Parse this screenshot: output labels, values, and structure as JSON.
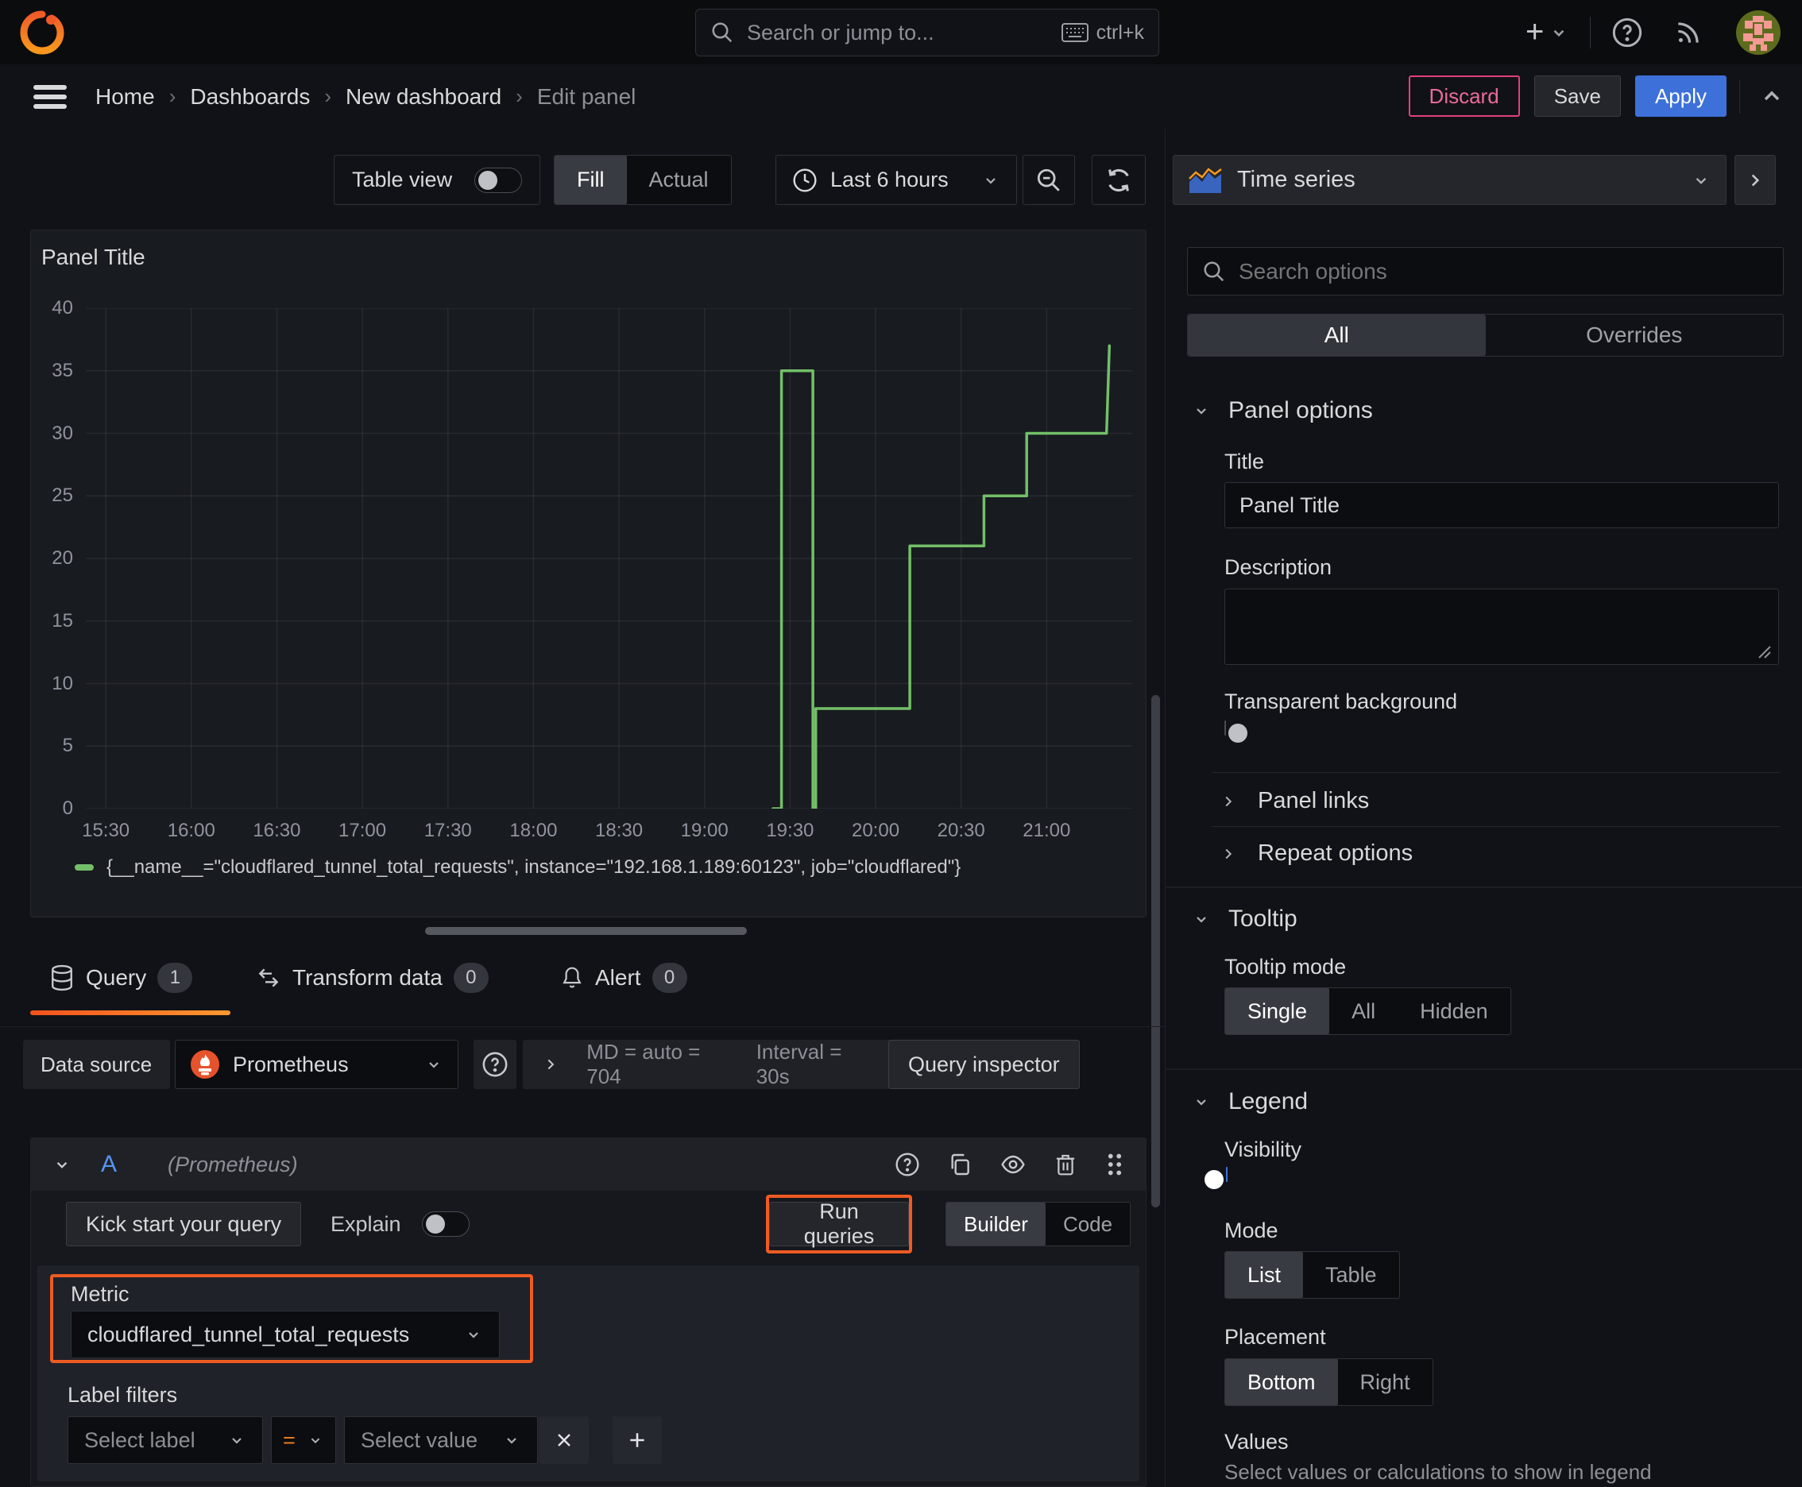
{
  "topbar": {
    "search_placeholder": "Search or jump to...",
    "shortcut": "ctrl+k"
  },
  "breadcrumb": {
    "items": [
      "Home",
      "Dashboards",
      "New dashboard",
      "Edit panel"
    ]
  },
  "actions": {
    "discard": "Discard",
    "save": "Save",
    "apply": "Apply"
  },
  "toolbar": {
    "table_view": "Table view",
    "fill": "Fill",
    "actual": "Actual",
    "time_range": "Last 6 hours"
  },
  "panel": {
    "title": "Panel Title"
  },
  "chart_data": {
    "type": "line",
    "step": true,
    "title": "Panel Title",
    "x_ticks": [
      "15:30",
      "16:00",
      "16:30",
      "17:00",
      "17:30",
      "18:00",
      "18:30",
      "19:00",
      "19:30",
      "20:00",
      "20:30",
      "21:00"
    ],
    "x_range": [
      "15:23",
      "21:30"
    ],
    "y_ticks": [
      0,
      5,
      10,
      15,
      20,
      25,
      30,
      35,
      40
    ],
    "ylim": [
      0,
      40
    ],
    "grid": true,
    "legend_position": "bottom",
    "series": [
      {
        "name": "{__name__=\"cloudflared_tunnel_total_requests\", instance=\"192.168.1.189:60123\", job=\"cloudflared\"}",
        "color": "#73bf69",
        "points": [
          [
            "19:24",
            0
          ],
          [
            "19:27",
            0
          ],
          [
            "19:27",
            35
          ],
          [
            "19:38",
            35
          ],
          [
            "19:38",
            0
          ],
          [
            "19:39",
            0
          ],
          [
            "19:39",
            8
          ],
          [
            "20:12",
            8
          ],
          [
            "20:12",
            21
          ],
          [
            "20:38",
            21
          ],
          [
            "20:38",
            25
          ],
          [
            "20:53",
            25
          ],
          [
            "20:53",
            30
          ],
          [
            "21:21",
            30
          ],
          [
            "21:22",
            37
          ]
        ]
      }
    ]
  },
  "tabs": [
    {
      "label": "Query",
      "count": "1"
    },
    {
      "label": "Transform data",
      "count": "0"
    },
    {
      "label": "Alert",
      "count": "0"
    }
  ],
  "datasource": {
    "label": "Data source",
    "name": "Prometheus",
    "stats_md": "MD = auto = 704",
    "stats_interval": "Interval = 30s",
    "inspector": "Query inspector"
  },
  "query": {
    "ref_id": "A",
    "datasource_hint": "(Prometheus)",
    "kickstart": "Kick start your query",
    "explain": "Explain",
    "run": "Run queries",
    "builder": "Builder",
    "code": "Code",
    "metric_label": "Metric",
    "metric_value": "cloudflared_tunnel_total_requests",
    "label_filters_label": "Label filters",
    "select_label": "Select label",
    "operator": "=",
    "select_value": "Select value"
  },
  "options": {
    "viz_type": "Time series",
    "search_placeholder": "Search options",
    "tab_all": "All",
    "tab_overrides": "Overrides",
    "panel_options": {
      "heading": "Panel options",
      "title_label": "Title",
      "title_value": "Panel Title",
      "description_label": "Description",
      "transparent_label": "Transparent background"
    },
    "collapsed": {
      "panel_links": "Panel links",
      "repeat_options": "Repeat options"
    },
    "tooltip": {
      "heading": "Tooltip",
      "mode_label": "Tooltip mode",
      "modes": [
        "Single",
        "All",
        "Hidden"
      ],
      "selected": "Single"
    },
    "legend": {
      "heading": "Legend",
      "visibility_label": "Visibility",
      "mode_label": "Mode",
      "modes": [
        "List",
        "Table"
      ],
      "selected_mode": "List",
      "placement_label": "Placement",
      "placements": [
        "Bottom",
        "Right"
      ],
      "selected_placement": "Bottom",
      "values_label": "Values",
      "values_help": "Select values or calculations to show in legend"
    }
  },
  "colors": {
    "accent_blue": "#3d71d9",
    "accent_orange": "#ee5b23",
    "series_green": "#73bf69",
    "discard_pink": "#e0417a"
  }
}
